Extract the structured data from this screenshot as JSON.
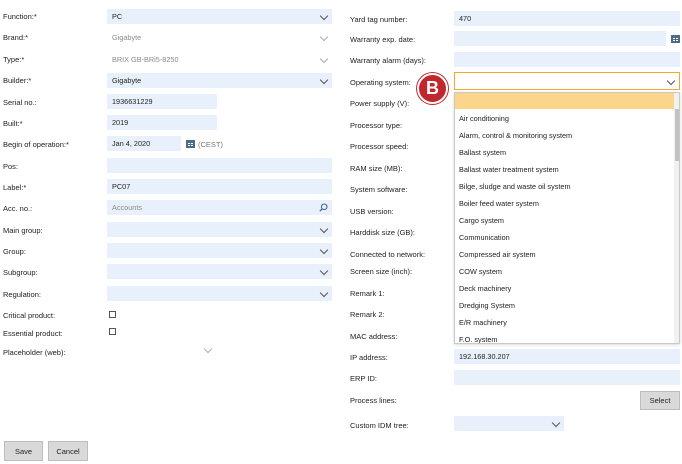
{
  "left": {
    "function": {
      "label": "Function:*",
      "value": "PC"
    },
    "brand": {
      "label": "Brand:*",
      "value": "Gigabyte"
    },
    "type": {
      "label": "Type:*",
      "value": "BRIX GB-BRi5-8250"
    },
    "builder": {
      "label": "Builder:*",
      "value": "Gigabyte"
    },
    "serial": {
      "label": "Serial no.:",
      "value": "1936631229"
    },
    "built": {
      "label": "Built:*",
      "value": "2019"
    },
    "begin": {
      "label": "Begin of operation:*",
      "value": "Jan 4, 2020",
      "tz": "(CEST)"
    },
    "pos": {
      "label": "Pos:",
      "value": ""
    },
    "labelfield": {
      "label": "Label:*",
      "value": "PC07"
    },
    "acc": {
      "label": "Acc. no.:",
      "placeholder": "Accounts"
    },
    "main_group": {
      "label": "Main group:",
      "value": ""
    },
    "group": {
      "label": "Group:",
      "value": ""
    },
    "subgroup": {
      "label": "Subgroup:",
      "value": ""
    },
    "regulation": {
      "label": "Regulation:",
      "value": ""
    },
    "critical": {
      "label": "Critical product:"
    },
    "essential": {
      "label": "Essential product:"
    },
    "placeholder_web": {
      "label": "Placeholder (web):"
    }
  },
  "right": {
    "yard_tag": {
      "label": "Yard tag number:",
      "value": "470"
    },
    "warranty_exp": {
      "label": "Warranty exp. date:",
      "value": ""
    },
    "warranty_alarm": {
      "label": "Warranty alarm (days):",
      "value": ""
    },
    "os": {
      "label": "Operating system:",
      "value": ""
    },
    "power": {
      "label": "Power supply (V):"
    },
    "proc_type": {
      "label": "Processor type:"
    },
    "proc_speed": {
      "label": "Processor speed:"
    },
    "ram": {
      "label": "RAM size (MB):"
    },
    "sys_sw": {
      "label": "System software:"
    },
    "usb": {
      "label": "USB version:"
    },
    "hdd": {
      "label": "Harddisk size (GB):"
    },
    "network": {
      "label": "Connected to network:"
    },
    "screen": {
      "label": "Screen size (inch):"
    },
    "remark1": {
      "label": "Remark 1:"
    },
    "remark2": {
      "label": "Remark 2:"
    },
    "mac": {
      "label": "MAC address:"
    },
    "ip": {
      "label": "IP address:",
      "value": "192.168.30.207"
    },
    "erp": {
      "label": "ERP ID:",
      "value": ""
    },
    "process": {
      "label": "Process lines:",
      "button": "Select"
    },
    "idm": {
      "label": "Custom IDM tree:",
      "value": ""
    }
  },
  "dropdown": {
    "options": [
      "Air conditioning",
      "Alarm, control & monitoring system",
      "Ballast system",
      "Ballast water treatment system",
      "Bilge, sludge and waste oil system",
      "Boiler feed water system",
      "Cargo system",
      "Communication",
      "Compressed air system",
      "COW system",
      "Deck machinery",
      "Dredging System",
      "E/R machinery",
      "F.O. system"
    ]
  },
  "marker": {
    "label": "B",
    "color": "#c0282e"
  },
  "actions": {
    "save": "Save",
    "cancel": "Cancel"
  },
  "colors": {
    "field_bg": "#e8f1fb",
    "highlight": "#fbd68a",
    "focus_border": "#f0a92b"
  }
}
